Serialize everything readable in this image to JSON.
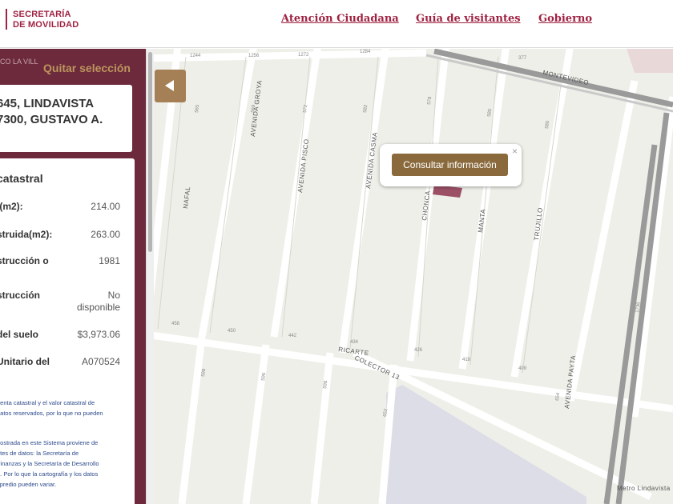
{
  "header": {
    "logo_line1": "SECRETARÍA",
    "logo_line2": "DE MOVILIDAD",
    "nav": [
      "Atención Ciudadana",
      "Guía de visitantes",
      "Gobierno"
    ]
  },
  "sidebar": {
    "alcaldia_text": "CO LA VILL",
    "quitar_label": "Quitar selección",
    "address_line1": "645, LINDAVISTA",
    "address_line2": "7300, GUSTAVO A.",
    "info_title": "catastral",
    "rows": [
      {
        "label": "l(m2):",
        "value": "214.00"
      },
      {
        "label": "struida(m2):",
        "value": "263.00"
      },
      {
        "label": "strucción o",
        "value": "1981"
      },
      {
        "label": "strucción",
        "value": "No disponible"
      },
      {
        "label": "del suelo",
        "value": "$3,973.06"
      },
      {
        "label": "Unitario del",
        "value": "A070524"
      }
    ],
    "note1": [
      "uenta catastral y el valor catastral de",
      "datos reservados, por lo que no pueden"
    ],
    "note2": [
      "nostrada en este Sistema proviene de",
      "ntes de datos: la Secretaría de",
      "Finanzas y la Secretaría de Desarrollo",
      "a. Por lo que la cartografía y los datos",
      "l predio pueden variar."
    ]
  },
  "map": {
    "popup_button": "Consultar información",
    "popup_close": "×",
    "streets": [
      "MONTEVIDEO",
      "NAFAL",
      "AVENIDA GROYA",
      "AVENIDA PISCO",
      "AVENIDA CASMA",
      "CHONCA",
      "MANTA",
      "TRUJILLO",
      "AVENIDA PAYTA",
      "RICARTE",
      "COLECTOR 13",
      "Metro Lindavista"
    ],
    "lot_numbers": [
      "1244",
      "1256",
      "1272",
      "1284",
      "377",
      "565",
      "569",
      "572",
      "582",
      "578",
      "580",
      "580",
      "458",
      "450",
      "442",
      "434",
      "426",
      "418",
      "409",
      "598",
      "596",
      "598",
      "652",
      "654",
      "1736"
    ]
  },
  "colors": {
    "brand": "#9f2241",
    "sidebar_bg": "#6d2a3d",
    "gold": "#bc955c",
    "popup_button": "#8a6a3c",
    "selected_lot": "#9b5066"
  }
}
